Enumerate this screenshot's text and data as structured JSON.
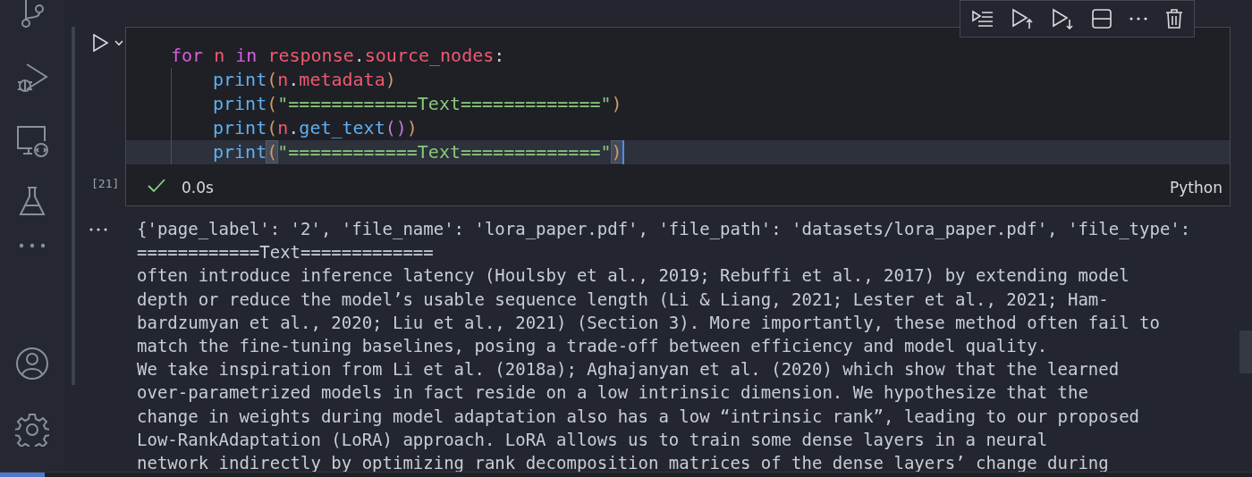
{
  "activity_bar": {
    "items": [
      {
        "kind": "source_control"
      },
      {
        "kind": "run_debug"
      },
      {
        "kind": "remote"
      },
      {
        "kind": "testing"
      },
      {
        "kind": "more"
      }
    ],
    "bottom_items": [
      {
        "kind": "account"
      },
      {
        "kind": "settings"
      }
    ]
  },
  "cell": {
    "selected": true,
    "toolbar": [
      {
        "kind": "run_by_line"
      },
      {
        "kind": "run_above"
      },
      {
        "kind": "run_below"
      },
      {
        "kind": "split"
      },
      {
        "kind": "more"
      },
      {
        "kind": "delete"
      }
    ],
    "code_lines": [
      {
        "current": false,
        "tokens": [
          {
            "kind": "keyword",
            "text": "for"
          },
          {
            "kind": "variable",
            "text": " n"
          },
          {
            "kind": "keyword",
            "text": " in"
          },
          {
            "kind": "variable",
            "text": " response"
          },
          {
            "kind": "plain",
            "text": "."
          },
          {
            "kind": "variable",
            "text": "source_nodes"
          },
          {
            "kind": "plain",
            "text": ":"
          }
        ],
        "children": [
          {
            "current": false,
            "tokens": [
              {
                "kind": "function",
                "text": "print"
              },
              {
                "kind": "bracket",
                "text": "("
              },
              {
                "kind": "variable",
                "text": "n"
              },
              {
                "kind": "plain",
                "text": "."
              },
              {
                "kind": "variable",
                "text": "metadata"
              },
              {
                "kind": "bracket",
                "text": ")"
              }
            ]
          },
          {
            "current": false,
            "tokens": [
              {
                "kind": "function",
                "text": "print"
              },
              {
                "kind": "bracket",
                "text": "("
              },
              {
                "kind": "string",
                "text": "\"============Text=============\""
              },
              {
                "kind": "bracket",
                "text": ")"
              }
            ]
          },
          {
            "current": false,
            "tokens": [
              {
                "kind": "function",
                "text": "print"
              },
              {
                "kind": "bracket",
                "text": "("
              },
              {
                "kind": "variable",
                "text": "n"
              },
              {
                "kind": "plain",
                "text": "."
              },
              {
                "kind": "function",
                "text": "get_text"
              },
              {
                "kind": "bracket2",
                "text": "()"
              },
              {
                "kind": "bracket",
                "text": ")"
              }
            ]
          },
          {
            "current": true,
            "tokens": [
              {
                "kind": "function",
                "text": "print"
              },
              {
                "kind": "bracket_match",
                "text": "("
              },
              {
                "kind": "string",
                "text": "\"============Text=============\""
              },
              {
                "kind": "bracket_match",
                "text": ")"
              }
            ]
          }
        ]
      }
    ],
    "execution_count": "[21]",
    "succeeded": true,
    "duration": "0.0s",
    "language": "Python"
  },
  "output": {
    "lines": [
      "{'page_label': '2', 'file_name': 'lora_paper.pdf', 'file_path': 'datasets/lora_paper.pdf', 'file_type':",
      "============Text=============",
      "often introduce inference latency (Houlsby et al., 2019; Rebuffi et al., 2017) by extending model",
      "depth or reduce the model’s usable sequence length (Li & Liang, 2021; Lester et al., 2021; Ham-",
      "bardzumyan et al., 2020; Liu et al., 2021) (Section 3). More importantly, these method often fail to",
      "match the fine-tuning baselines, posing a trade-off between efficiency and model quality.",
      "We take inspiration from Li et al. (2018a); Aghajanyan et al. (2020) which show that the learned",
      "over-parametrized models in fact reside on a low intrinsic dimension. We hypothesize that the",
      "change in weights during model adaptation also has a low “intrinsic rank”, leading to our proposed",
      "Low-RankAdaptation (LoRA) approach. LoRA allows us to train some dense layers in a neural",
      "network indirectly by optimizing rank decomposition matrices of the dense layers’ change during"
    ]
  }
}
